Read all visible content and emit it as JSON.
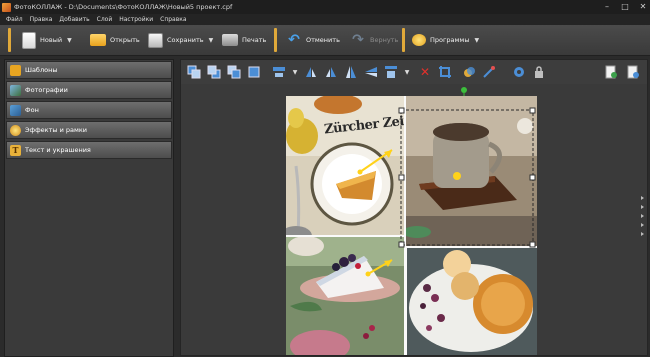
{
  "app": {
    "title": "ФотоКОЛЛАЖ - D:\\Documents\\ФотоКОЛЛАЖ\\Новый5 проект.cpf"
  },
  "window_controls": {
    "minimize": "–",
    "maximize": "□",
    "close": "✕"
  },
  "menu": [
    "Файл",
    "Правка",
    "Добавить",
    "Слой",
    "Настройки",
    "Справка"
  ],
  "toolbar": {
    "new": "Новый",
    "open": "Открыть",
    "save": "Сохранить",
    "print": "Печать",
    "undo": "Отменить",
    "redo": "Вернуть",
    "programs": "Программы"
  },
  "sidebar": {
    "items": [
      {
        "label": "Шаблоны",
        "icon": "star-icon"
      },
      {
        "label": "Фотографии",
        "icon": "photo-icon"
      },
      {
        "label": "Фон",
        "icon": "background-icon"
      },
      {
        "label": "Эффекты и рамки",
        "icon": "effects-icon"
      },
      {
        "label": "Текст и украшения",
        "icon": "text-icon"
      }
    ]
  },
  "collage": {
    "newspaper_text": "Zürcher Zeit"
  },
  "colors": {
    "accent": "#e0a93a",
    "panel": "#3a3a3a",
    "handle": "#ffd21a"
  }
}
